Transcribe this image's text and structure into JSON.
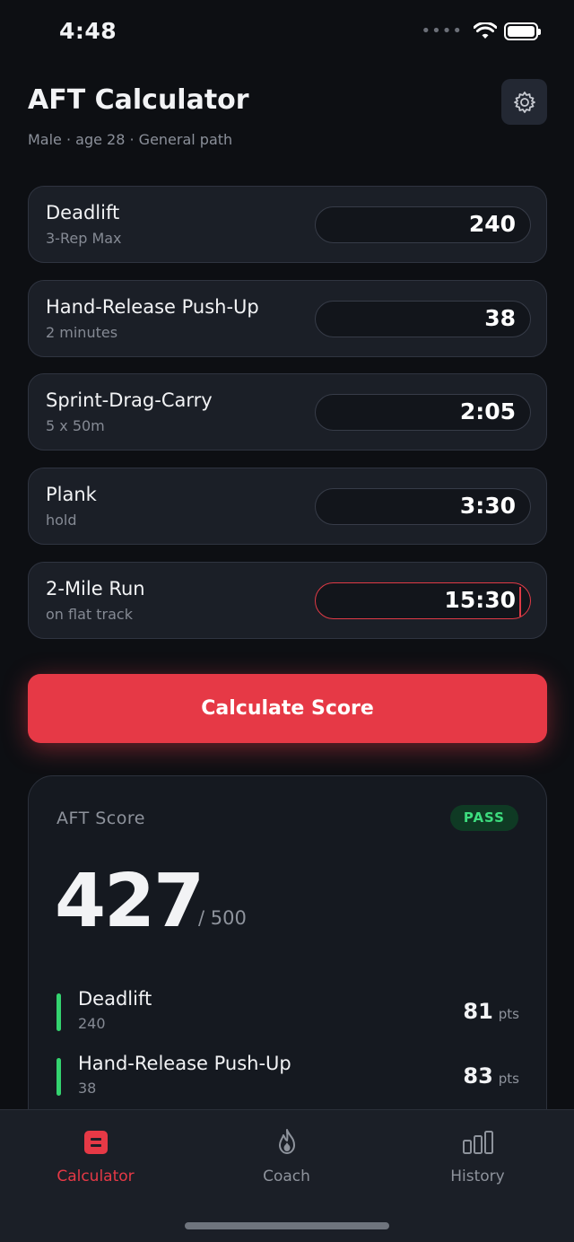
{
  "status_bar": {
    "time": "4:48"
  },
  "header": {
    "title": "AFT Calculator",
    "subtitle": "Male · age 28 · General path"
  },
  "events": [
    {
      "name": "Deadlift",
      "sub": "3-Rep Max",
      "value": "240"
    },
    {
      "name": "Hand-Release Push-Up",
      "sub": "2 minutes",
      "value": "38"
    },
    {
      "name": "Sprint-Drag-Carry",
      "sub": "5 x 50m",
      "value": "2:05"
    },
    {
      "name": "Plank",
      "sub": "hold",
      "value": "3:30"
    },
    {
      "name": "2-Mile Run",
      "sub": "on flat track",
      "value": "15:30"
    }
  ],
  "calculate_label": "Calculate Score",
  "score": {
    "label": "AFT Score",
    "badge": "PASS",
    "value": "427",
    "max": "/ 500",
    "breakdown": [
      {
        "name": "Deadlift",
        "value": "240",
        "points": "81",
        "unit": "pts"
      },
      {
        "name": "Hand-Release Push-Up",
        "value": "38",
        "points": "83",
        "unit": "pts"
      }
    ]
  },
  "tabs": [
    {
      "label": "Calculator",
      "icon": "calculator-icon",
      "active": true
    },
    {
      "label": "Coach",
      "icon": "flame-icon",
      "active": false
    },
    {
      "label": "History",
      "icon": "bar-chart-icon",
      "active": false
    }
  ],
  "colors": {
    "accent": "#e63946",
    "pass": "#3ddc7e",
    "background": "#0d0f13",
    "card": "#1b1f27"
  }
}
